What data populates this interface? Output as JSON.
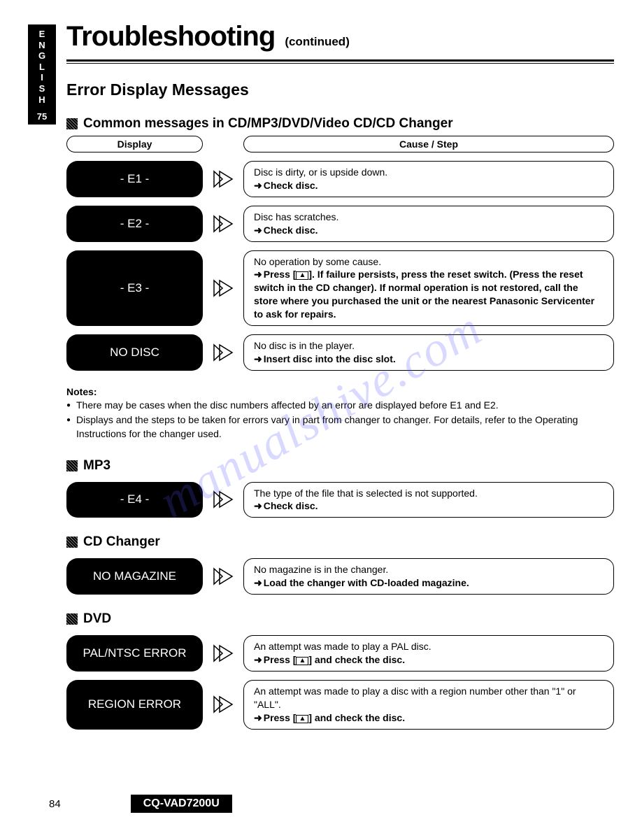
{
  "lang": "ENGLISH",
  "lang_page": "75",
  "title": "Troubleshooting",
  "continued": "(continued)",
  "section": "Error Display Messages",
  "headers": {
    "display": "Display",
    "cause": "Cause / Step"
  },
  "groups": [
    {
      "heading": "Common messages in CD/MP3/DVD/Video CD/CD Changer",
      "show_headers": true,
      "rows": [
        {
          "display": "- E1 -",
          "cause": "Disc is dirty, or is upside down.",
          "step": "Check disc."
        },
        {
          "display": "- E2 -",
          "cause": "Disc has scratches.",
          "step": "Check disc."
        },
        {
          "display": "- E3 -",
          "cause": "No operation by some cause.",
          "step": "Press [EJECT]. If failure persists, press the reset switch. (Press the reset switch in the CD changer). If normal operation is not restored, call the store where you purchased the unit or the nearest Panasonic Servicenter to ask for repairs."
        },
        {
          "display": "NO DISC",
          "cause": "No disc is in the player.",
          "step": "Insert disc into the disc slot."
        }
      ],
      "notes_title": "Notes:",
      "notes": [
        "There may be cases when the disc numbers affected by an error are displayed before E1 and E2.",
        "Displays and the steps to be taken for errors vary in part from changer to changer. For details, refer to the Operating Instructions for the changer used."
      ]
    },
    {
      "heading": "MP3",
      "rows": [
        {
          "display": "- E4 -",
          "cause": "The type of the file that is selected is not supported.",
          "step": "Check disc."
        }
      ]
    },
    {
      "heading": "CD Changer",
      "rows": [
        {
          "display": "NO MAGAZINE",
          "cause": "No magazine is in the changer.",
          "step": "Load the changer with CD-loaded magazine."
        }
      ]
    },
    {
      "heading": "DVD",
      "rows": [
        {
          "display": "PAL/NTSC ERROR",
          "cause": "An attempt was made to play a PAL disc.",
          "step": "Press [EJECT] and check the disc."
        },
        {
          "display": "REGION ERROR",
          "cause": "An attempt was made to play a disc with a region number other than \"1\" or \"ALL\".",
          "step": "Press [EJECT] and check the disc."
        }
      ]
    }
  ],
  "footer": {
    "page": "84",
    "model": "CQ-VAD7200U"
  },
  "watermark": "manualshive.com"
}
